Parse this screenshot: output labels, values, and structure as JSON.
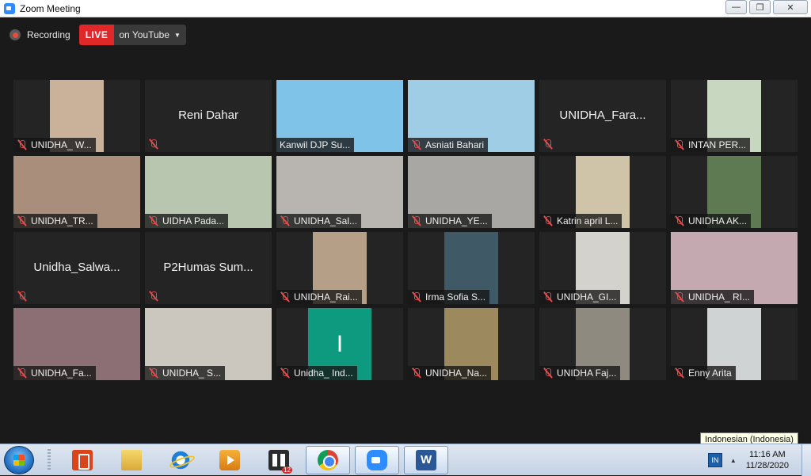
{
  "window": {
    "title": "Zoom Meeting"
  },
  "meeting": {
    "recording_label": "Recording",
    "live_label": "LIVE",
    "stream_label": "on YouTube"
  },
  "tiles": [
    {
      "name": "UNIDHA_ W...",
      "kind": "video",
      "bg": "#c9b19a",
      "active": false
    },
    {
      "name": "Reni Dahar",
      "kind": "name",
      "active": false
    },
    {
      "name": "Kanwil DJP Su...",
      "kind": "share",
      "bg": "#7fc3e8",
      "active": true
    },
    {
      "name": "Asniati Bahari",
      "kind": "wide",
      "bg": "#9fcde6",
      "active": false
    },
    {
      "name": "UNIDHA_Fara...",
      "kind": "name",
      "active": false
    },
    {
      "name": "INTAN PER...",
      "kind": "video",
      "bg": "#c7d7c0",
      "active": false
    },
    {
      "name": "UNIDHA_TR...",
      "kind": "wide",
      "bg": "#a98e7c",
      "active": false
    },
    {
      "name": "UIDHA Pada...",
      "kind": "wide",
      "bg": "#b8c6b0",
      "active": false
    },
    {
      "name": "UNIDHA_Sal...",
      "kind": "wide",
      "bg": "#b8b5b0",
      "active": false
    },
    {
      "name": "UNIDHA_YE...",
      "kind": "wide",
      "bg": "#a9a7a4",
      "active": false
    },
    {
      "name": "Katrin april L...",
      "kind": "video",
      "bg": "#cfc4a8",
      "active": false
    },
    {
      "name": "UNIDHA AK...",
      "kind": "video",
      "bg": "#5e7a52",
      "active": false
    },
    {
      "name": "Unidha_Salwa...",
      "kind": "name",
      "active": false
    },
    {
      "name": "P2Humas Sum...",
      "kind": "name",
      "active": false
    },
    {
      "name": "UNIDHA_Rai...",
      "kind": "video",
      "bg": "#b59f86",
      "active": false
    },
    {
      "name": "Irma Sofia S...",
      "kind": "video",
      "bg": "#3f5a66",
      "active": false
    },
    {
      "name": "UNIDHA_GI...",
      "kind": "video",
      "bg": "#d4d2cc",
      "active": false
    },
    {
      "name": "UNIDHA_ RI...",
      "kind": "wide",
      "bg": "#c5a9b0",
      "active": false
    },
    {
      "name": "UNIDHA_Fa...",
      "kind": "wide",
      "bg": "#8c6f74",
      "active": false
    },
    {
      "name": "UNIDHA_ S...",
      "kind": "wide",
      "bg": "#cbc7be",
      "active": false
    },
    {
      "name": "Unidha_ Ind...",
      "kind": "letter",
      "letter": "I",
      "active": false
    },
    {
      "name": "UNIDHA_Na...",
      "kind": "video",
      "bg": "#9c8a5e",
      "active": false
    },
    {
      "name": "UNIDHA Faj...",
      "kind": "video",
      "bg": "#8f8a80",
      "active": false
    },
    {
      "name": "Enny Arita",
      "kind": "video",
      "bg": "#cfd3d4",
      "active": false
    }
  ],
  "taskbar": {
    "tray_lang": "IN",
    "time": "11:16 AM",
    "date": "11/28/2020",
    "lang_tooltip": "Indonesian (Indonesia)",
    "apps_badge": "12"
  },
  "colors": {
    "live": "#e02828",
    "active_speaker": "#cde53c",
    "muted": "#e34c4c"
  }
}
